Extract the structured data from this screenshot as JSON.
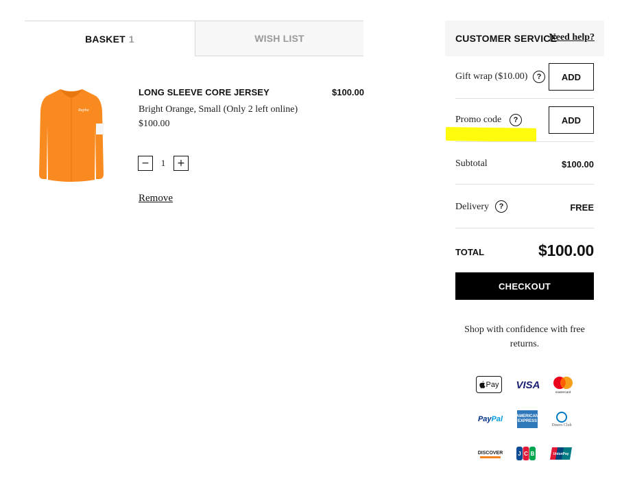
{
  "tabs": {
    "basket_label": "BASKET",
    "basket_count": "1",
    "wishlist_label": "WISH LIST"
  },
  "item": {
    "name": "LONG SLEEVE CORE JERSEY",
    "line_total": "$100.00",
    "variant": "Bright Orange, Small (Only 2 left online)",
    "unit_price": "$100.00",
    "quantity": "1",
    "minus_symbol": "−",
    "plus_symbol": "+",
    "remove_label": "Remove",
    "image_icon": "orange-long-sleeve-jersey",
    "jersey_color": "#f98a1f"
  },
  "sidebar": {
    "customer_service": "CUSTOMER SERVICE",
    "need_help": "Need help?",
    "gift_wrap_label": "Gift wrap ($10.00)",
    "gift_wrap_button": "ADD",
    "promo_label": "Promo code",
    "promo_button": "ADD",
    "help_symbol": "?",
    "subtotal_label": "Subtotal",
    "subtotal_value": "$100.00",
    "delivery_label": "Delivery",
    "delivery_value": "FREE",
    "total_label": "TOTAL",
    "total_value": "$100.00",
    "checkout_label": "CHECKOUT",
    "confidence_text": "Shop with confidence with free returns.",
    "highlight_color": "#fffb00"
  },
  "payment": {
    "applepay_text": "Pay",
    "visa_text": "VISA",
    "mastercard_text": "mastercard",
    "paypal_pay": "Pay",
    "paypal_pal": "Pal",
    "amex_text": "AMERICAN EXPRESS",
    "diners_text": "Diners Club",
    "discover_text": "DISCOVER",
    "icons": [
      "apple-pay-icon",
      "visa-icon",
      "mastercard-icon",
      "paypal-icon",
      "amex-icon",
      "diners-club-icon",
      "discover-icon",
      "jcb-icon",
      "unionpay-icon"
    ]
  }
}
